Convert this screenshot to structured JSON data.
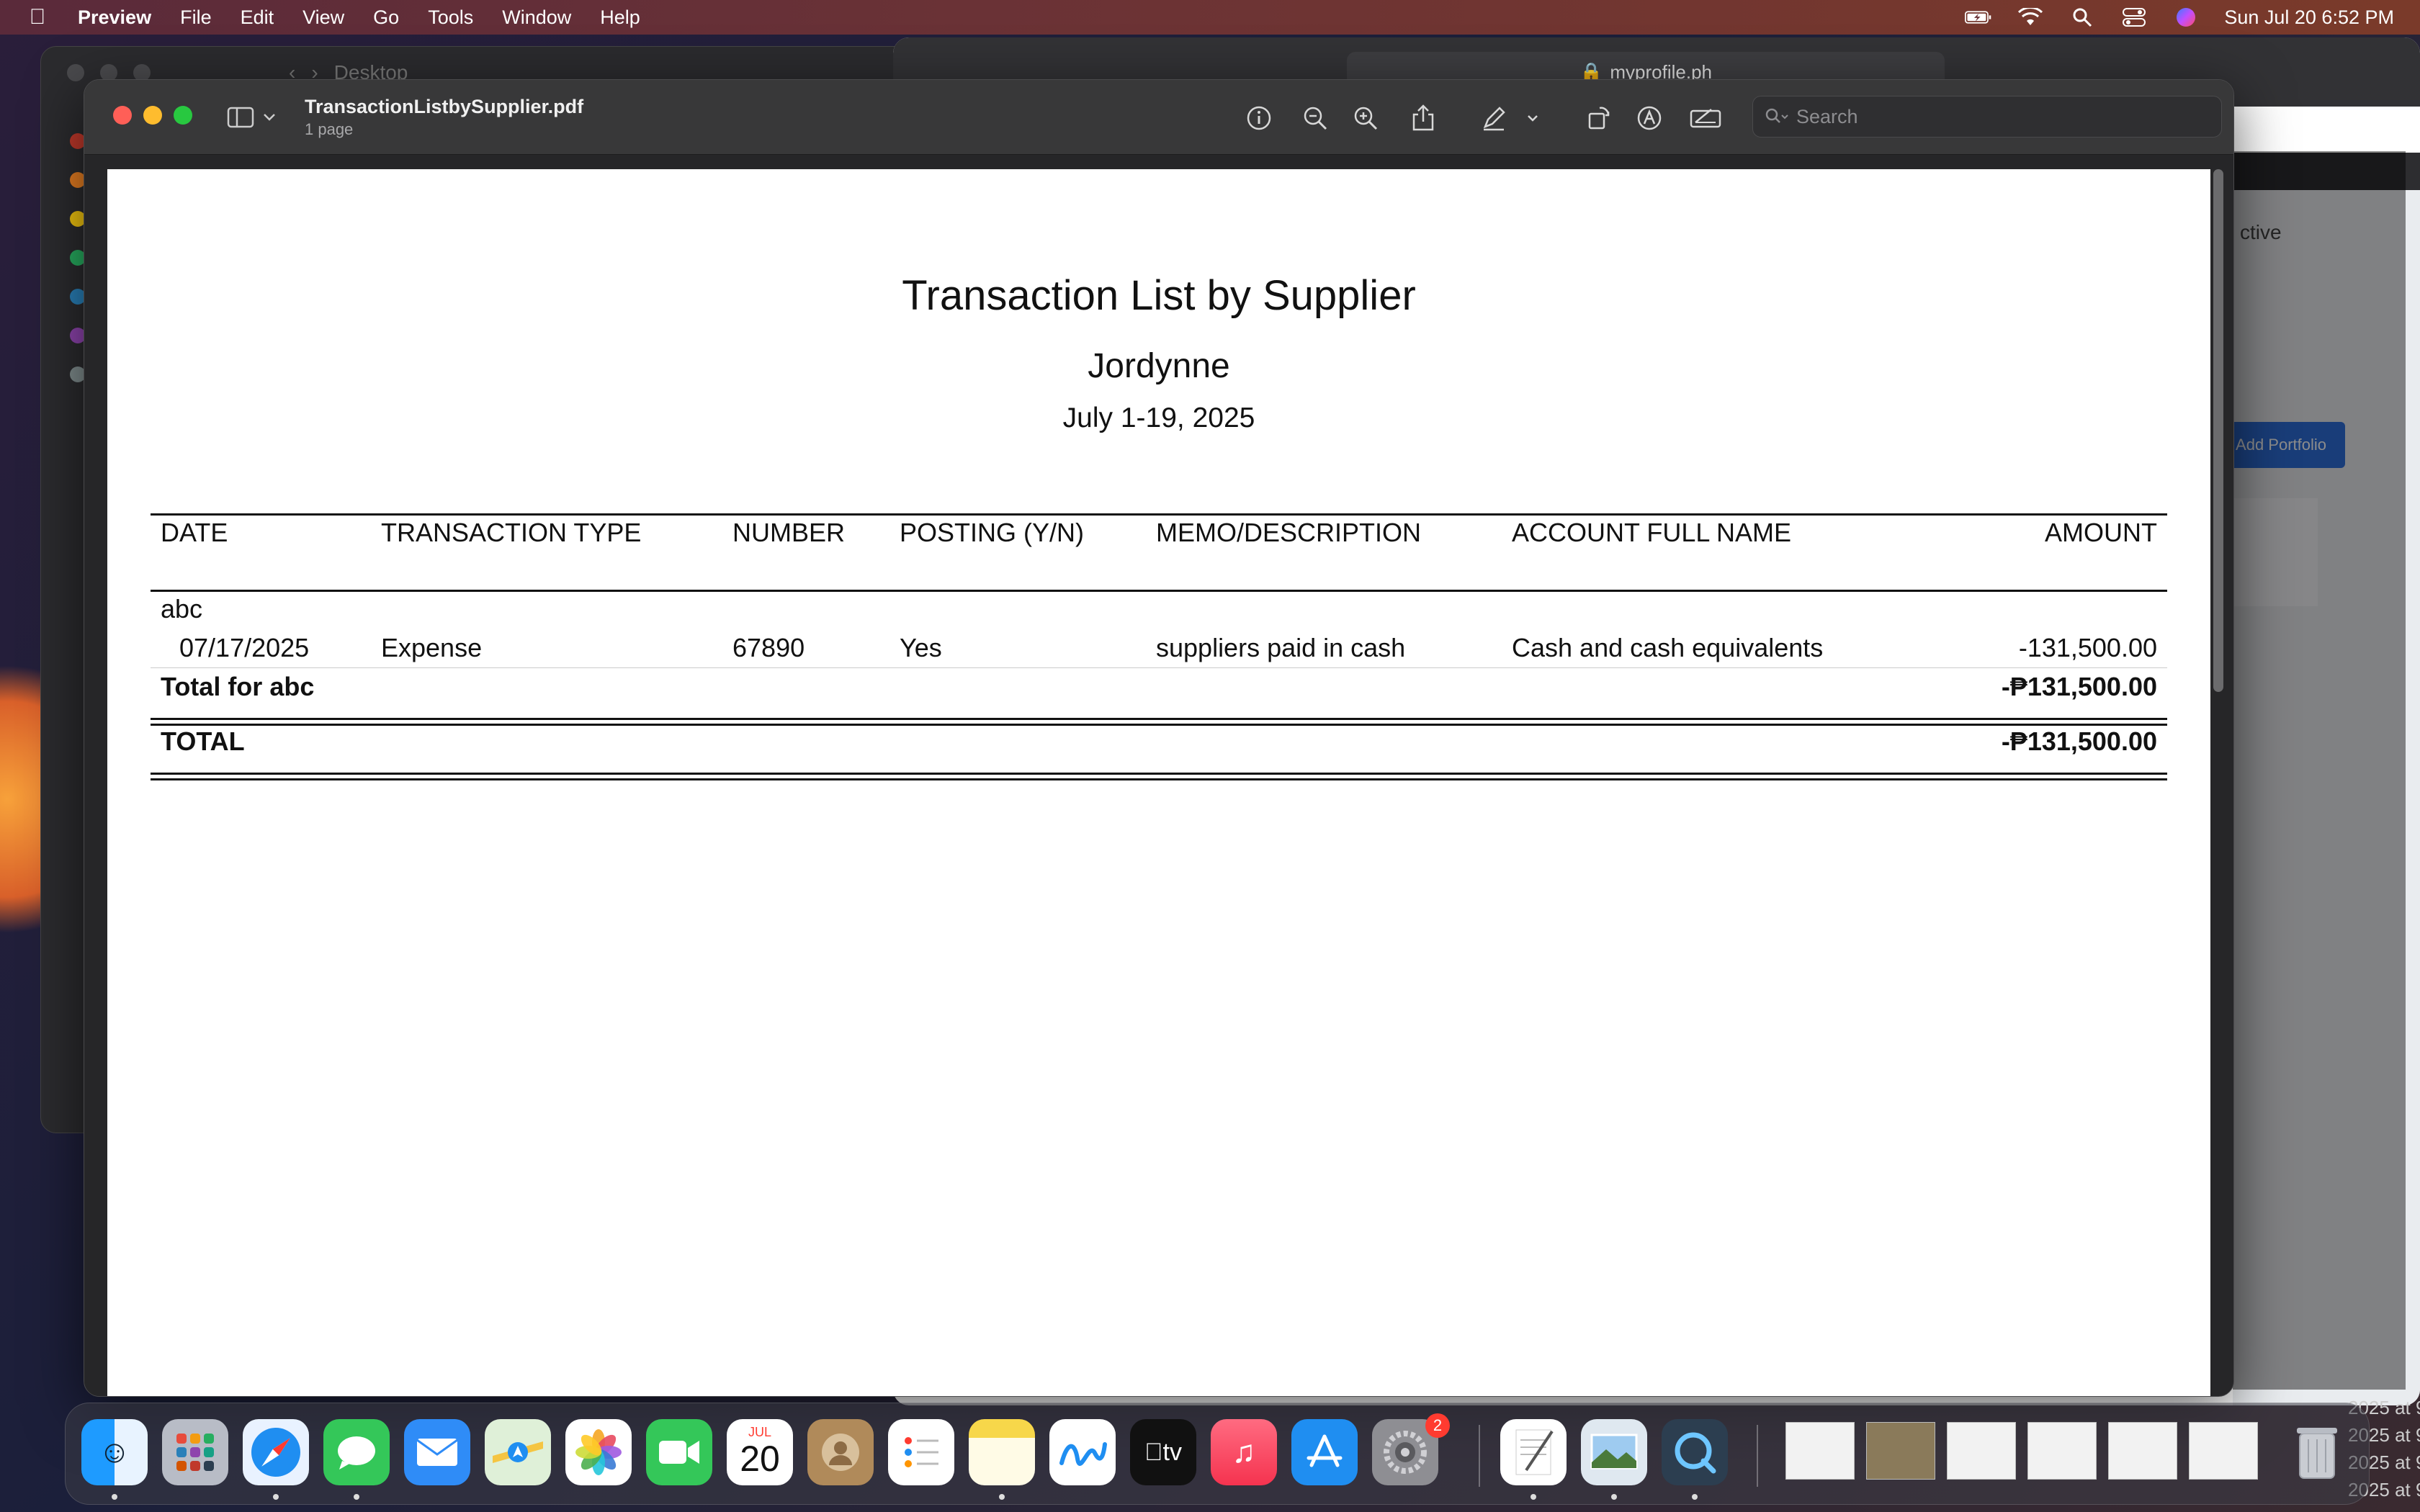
{
  "menubar": {
    "app_name": "Preview",
    "items": [
      "File",
      "Edit",
      "View",
      "Go",
      "Tools",
      "Window",
      "Help"
    ],
    "clock": "Sun Jul 20  6:52 PM"
  },
  "background": {
    "finder_title": "Desktop",
    "safari_url": "myprofile.ph",
    "safari_status": "ctive",
    "safari_button": "Add Portfolio",
    "finder_list": [
      "2025 at 9",
      "2025 at 9",
      "2025 at 9",
      "2025 at 9"
    ]
  },
  "preview": {
    "file_name": "TransactionListbySupplier.pdf",
    "page_count": "1 page",
    "search_placeholder": "Search"
  },
  "report": {
    "title": "Transaction List by Supplier",
    "company": "Jordynne",
    "period": "July 1-19, 2025",
    "columns": [
      "DATE",
      "TRANSACTION TYPE",
      "NUMBER",
      "POSTING (Y/N)",
      "MEMO/DESCRIPTION",
      "ACCOUNT FULL NAME",
      "AMOUNT"
    ],
    "group": {
      "name": "abc",
      "rows": [
        {
          "date": "07/17/2025",
          "type": "Expense",
          "number": "67890",
          "posting": "Yes",
          "memo": "suppliers paid in cash",
          "account": "Cash and cash equivalents",
          "amount": "-131,500.00"
        }
      ],
      "total_label": "Total for abc",
      "total_amount": "-₱131,500.00"
    },
    "grand_total_label": "TOTAL",
    "grand_total_amount": "-₱131,500.00"
  },
  "dock": {
    "calendar_month": "JUL",
    "calendar_day": "20",
    "settings_badge": "2",
    "tv_label": "tv"
  },
  "colors": {
    "report_text": "#111111",
    "page_bg": "#ffffff",
    "window_chrome": "#383839",
    "close": "#ff5f57",
    "minimize": "#febc2e",
    "zoom": "#28c840"
  }
}
